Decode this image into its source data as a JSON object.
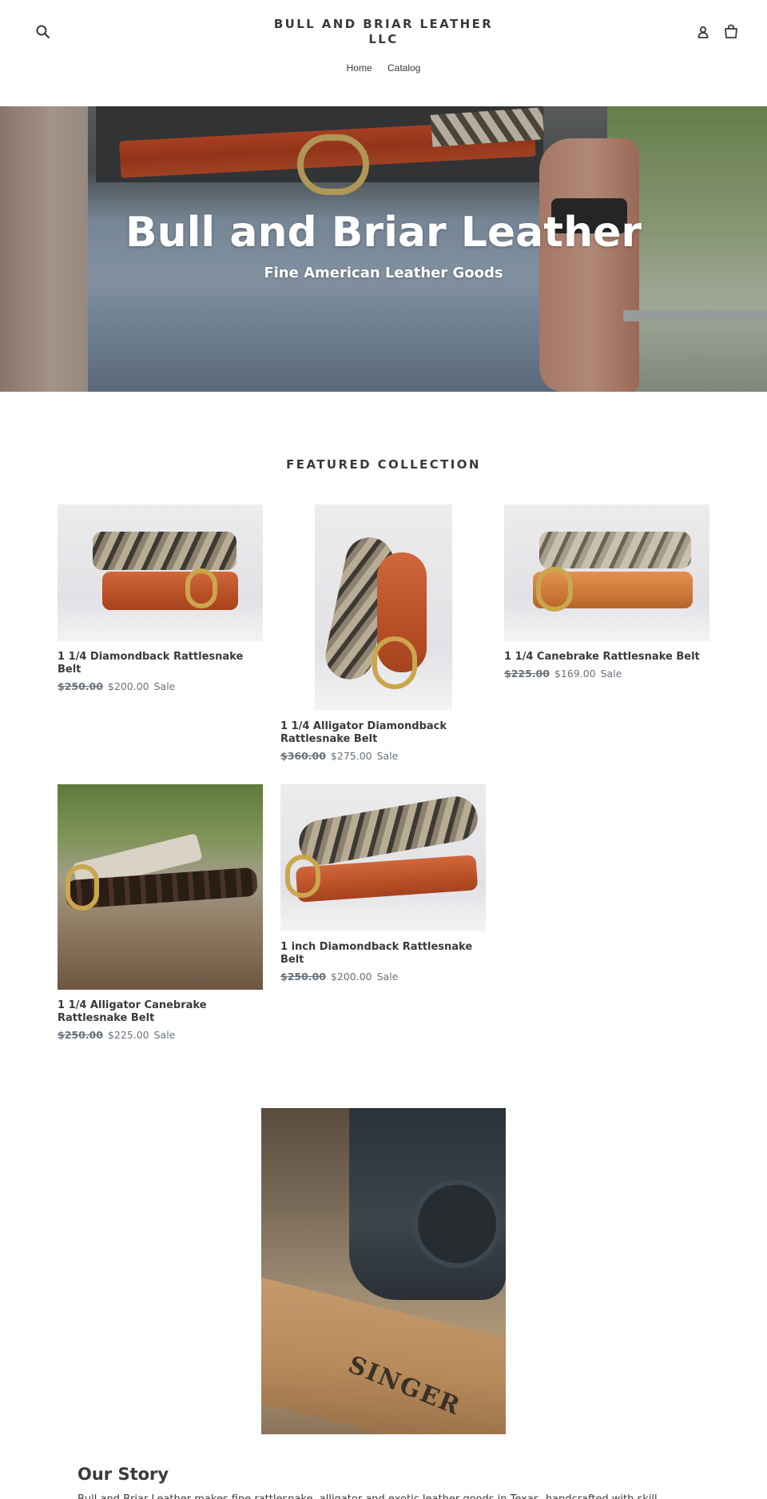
{
  "header": {
    "shop_name": "BULL AND BRIAR LEATHER LLC",
    "nav": [
      "Home",
      "Catalog"
    ],
    "icons": {
      "search": "search-icon",
      "account": "user-icon",
      "cart": "cart-icon"
    }
  },
  "hero": {
    "title": "Bull and Briar Leather",
    "subtitle": "Fine American Leather Goods"
  },
  "featured": {
    "title": "FEATURED COLLECTION",
    "products": [
      {
        "name": "1 1/4 Diamondback Rattlesnake Belt",
        "compare_price": "$250.00",
        "price": "$200.00",
        "badge": "Sale"
      },
      {
        "name": "1 1/4 Alligator Diamondback Rattlesnake Belt",
        "compare_price": "$360.00",
        "price": "$275.00",
        "badge": "Sale"
      },
      {
        "name": "1 1/4 Canebrake Rattlesnake Belt",
        "compare_price": "$225.00",
        "price": "$169.00",
        "badge": "Sale"
      },
      {
        "name": "1 1/4 Alligator Canebrake Rattlesnake Belt",
        "compare_price": "$250.00",
        "price": "$225.00",
        "badge": "Sale"
      },
      {
        "name": "1 inch Diamondback Rattlesnake Belt",
        "compare_price": "$250.00",
        "price": "$200.00",
        "badge": "Sale"
      }
    ]
  },
  "story": {
    "image_text": "SINGER",
    "title": "Our Story",
    "text": "Bull and Briar Leather makes fine rattlesnake, alligator and exotic leather goods in Texas, handcrafted with skill."
  },
  "colors": {
    "text": "#3a3a3a",
    "price": "#69727b",
    "background": "#ffffff"
  }
}
